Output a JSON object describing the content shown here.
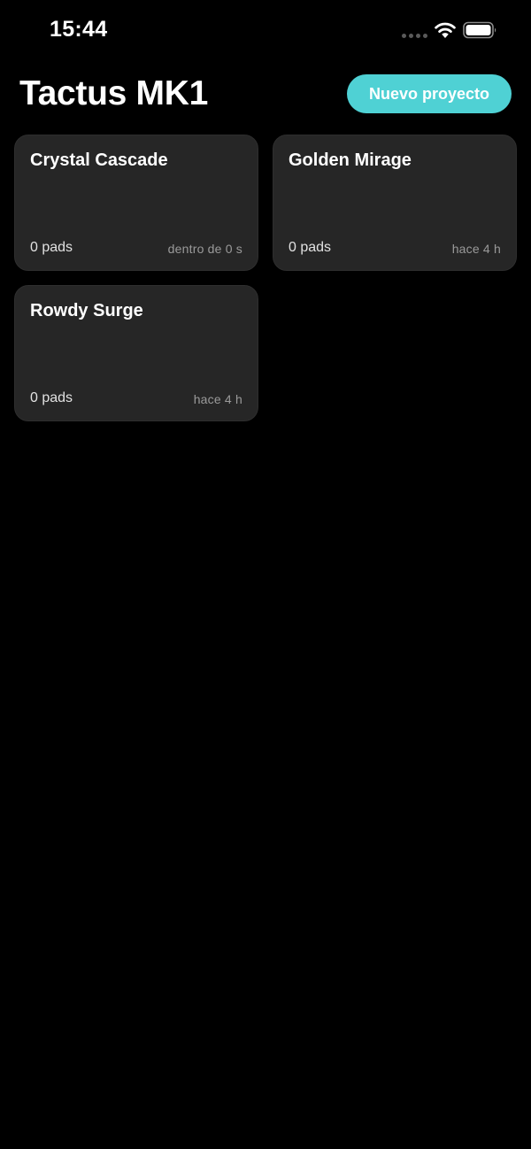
{
  "status_bar": {
    "time": "15:44",
    "icons": [
      "signal-dots-icon",
      "wifi-icon",
      "battery-icon"
    ]
  },
  "header": {
    "title": "Tactus MK1",
    "new_project_label": "Nuevo proyecto"
  },
  "colors": {
    "background": "#000000",
    "card": "#262626",
    "accent": "#4fd1d4",
    "text": "#ffffff",
    "muted_text": "#9a9a9a"
  },
  "projects": [
    {
      "name": "Crystal Cascade",
      "pads": "0 pads",
      "time": "dentro de 0 s"
    },
    {
      "name": "Golden Mirage",
      "pads": "0 pads",
      "time": "hace 4 h"
    },
    {
      "name": "Rowdy Surge",
      "pads": "0 pads",
      "time": "hace 4 h"
    }
  ]
}
